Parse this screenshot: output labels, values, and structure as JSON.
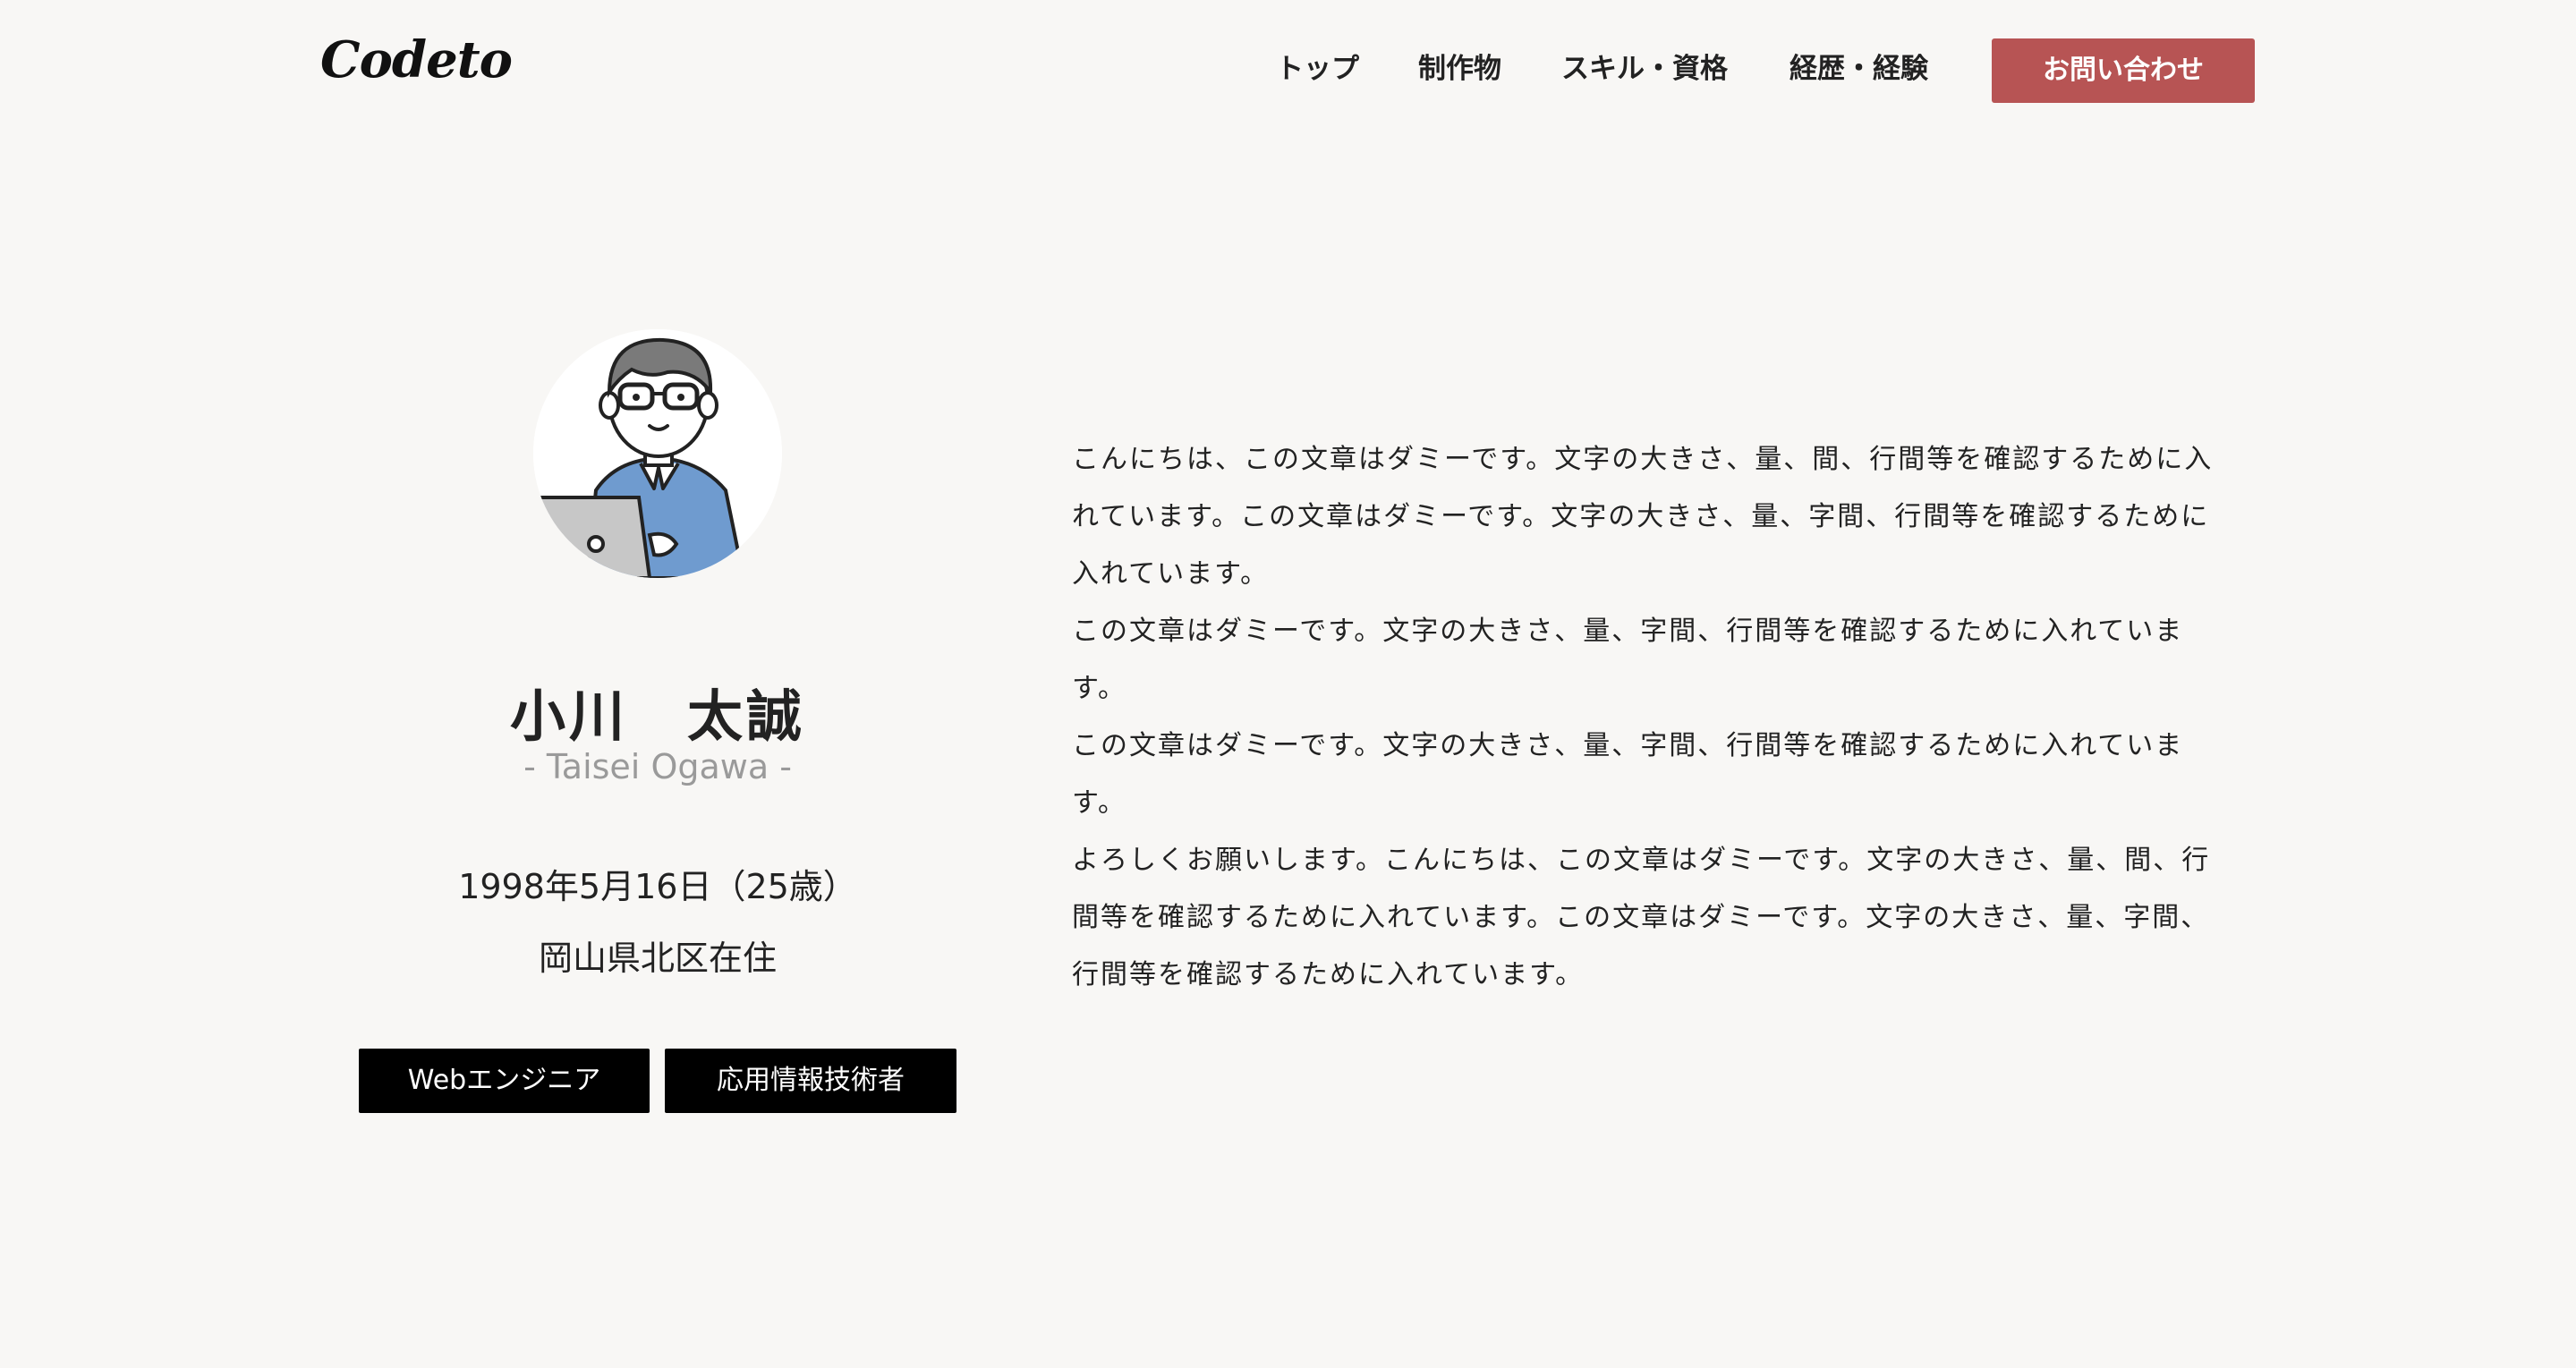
{
  "header": {
    "logo": "Codeto",
    "nav": [
      "トップ",
      "制作物",
      "スキル・資格",
      "経歴・経験"
    ],
    "contact_label": "お問い合わせ"
  },
  "profile": {
    "name": "小川　太誠",
    "romaji": "- Taisei Ogawa -",
    "birth": "1998年5月16日（25歳）",
    "address": "岡山県北区在住",
    "tags": [
      "Webエンジニア",
      "応用情報技術者"
    ]
  },
  "intro": {
    "paragraphs": [
      "こんにちは、この文章はダミーです。文字の大きさ、量、間、行間等を確認するために入れています。この文章はダミーです。文字の大きさ、量、字間、行間等を確認するために入れています。",
      "この文章はダミーです。文字の大きさ、量、字間、行間等を確認するために入れています。",
      "この文章はダミーです。文字の大きさ、量、字間、行間等を確認するために入れています。",
      "よろしくお願いします。こんにちは、この文章はダミーです。文字の大きさ、量、間、行間等を確認するために入れています。この文章はダミーです。文字の大きさ、量、字間、行間等を確認するために入れています。"
    ]
  },
  "colors": {
    "background": "#f8f7f5",
    "accent": "#b75454",
    "tag_bg": "#000000",
    "muted": "#9a9a9a"
  }
}
